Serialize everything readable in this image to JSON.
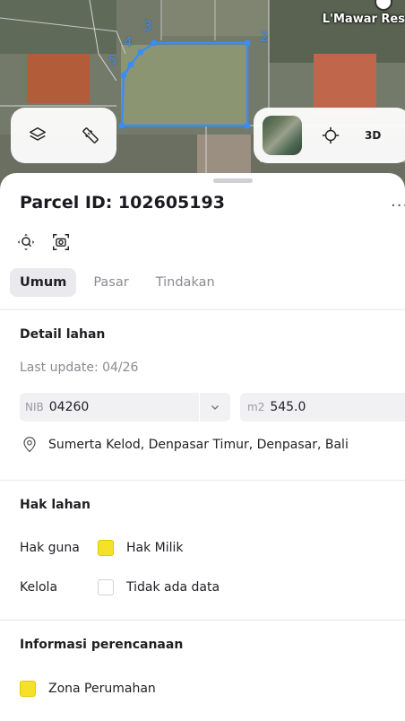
{
  "map": {
    "place_label": "L'Mawar Res",
    "vertex_labels": [
      "2",
      "3",
      "4",
      "5"
    ],
    "controls": {
      "layers_icon": "layers-icon",
      "measure_icon": "ruler-icon",
      "locate_icon": "crosshair-icon",
      "view_3d_label": "3D"
    },
    "colors": {
      "parcel_outline": "#3a8df2"
    }
  },
  "parcel": {
    "title": "Parcel ID: 102605193",
    "more_label": "···"
  },
  "tabs": [
    {
      "label": "Umum",
      "active": true
    },
    {
      "label": "Pasar",
      "active": false
    },
    {
      "label": "Tindakan",
      "active": false
    }
  ],
  "detail": {
    "title": "Detail lahan",
    "last_update": "Last update: 04/26",
    "nib_tag": "NIB",
    "nib_value": "04260",
    "area_unit": "m2",
    "area_value": "545.0",
    "address": "Sumerta Kelod, Denpasar Timur, Denpasar, Bali"
  },
  "rights": {
    "title": "Hak lahan",
    "rows": [
      {
        "label": "Hak guna",
        "value": "Hak Milik",
        "color": "#f6e12a"
      },
      {
        "label": "Kelola",
        "value": "Tidak ada data",
        "color": "#ffffff"
      }
    ]
  },
  "planning": {
    "title": "Informasi perencanaan",
    "zone": "Zona Perumahan",
    "zone_color": "#f6e12a"
  }
}
